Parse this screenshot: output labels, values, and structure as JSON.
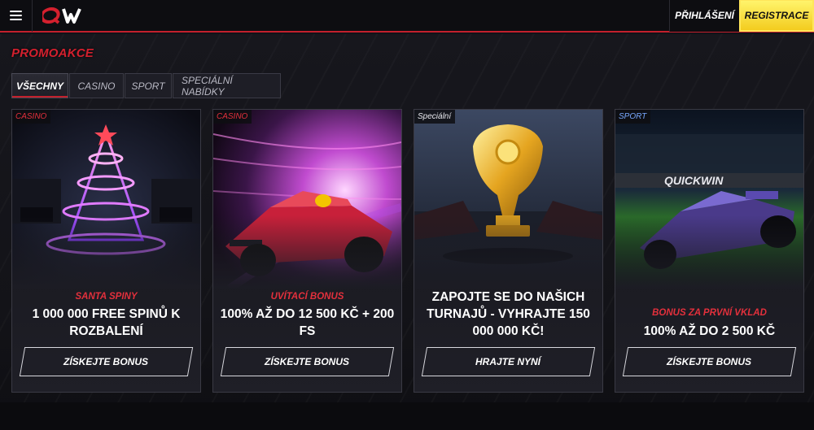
{
  "header": {
    "logo_text": "QW",
    "login_label": "PŘIHLÁŠENÍ",
    "register_label": "REGISTRACE"
  },
  "page": {
    "title": "PROMOAKCE"
  },
  "tabs": [
    {
      "label": "VŠECHNY",
      "active": true
    },
    {
      "label": "CASINO",
      "active": false
    },
    {
      "label": "SPORT",
      "active": false
    },
    {
      "label": "SPECIÁLNÍ NABÍDKY",
      "active": false
    }
  ],
  "cards": [
    {
      "badge": "CASINO",
      "subtitle": "SANTA SPINY",
      "title": "1 000 000 FREE SPINŮ K ROZBALENÍ",
      "button": "ZÍSKEJTE BONUS"
    },
    {
      "badge": "CASINO",
      "subtitle": "UVÍTACÍ BONUS",
      "title": "100% AŽ DO 12 500 KČ + 200 FS",
      "button": "ZÍSKEJTE BONUS"
    },
    {
      "badge": "Speciální",
      "subtitle": "",
      "title": "ZAPOJTE SE DO NAŠICH TURNAJŮ - VYHRAJTE 150 000 000 KČ!",
      "button": "HRAJTE NYNÍ"
    },
    {
      "badge": "SPORT",
      "subtitle": "BONUS ZA PRVNÍ VKLAD",
      "title": "100% AŽ DO 2 500 KČ",
      "button": "ZÍSKEJTE BONUS",
      "banner_text": "QUICKWIN"
    }
  ],
  "colors": {
    "accent_red": "#c3202c",
    "register_yellow": "#f3cc1f",
    "sport_blue": "#79a8ff"
  }
}
